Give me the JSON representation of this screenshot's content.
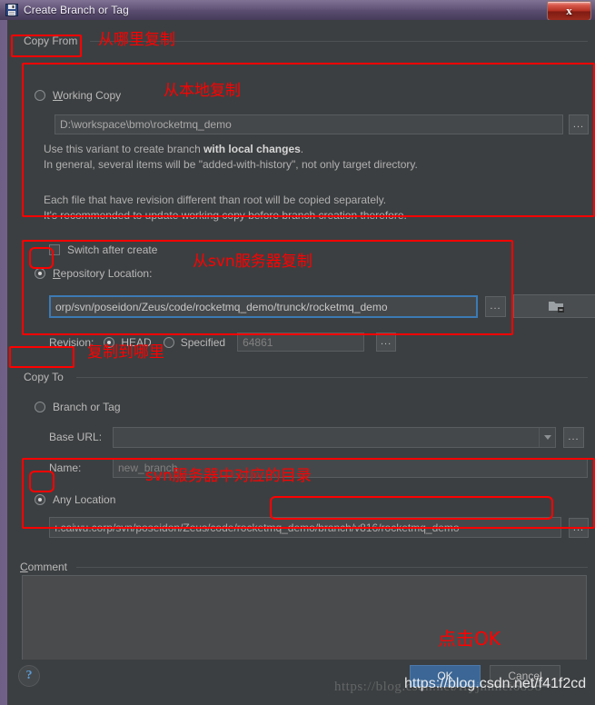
{
  "window": {
    "title": "Create Branch or Tag",
    "icon": "save-floppy-icon",
    "close_label": "x"
  },
  "copy_from": {
    "section_label": "Copy From",
    "annotation": "从哪里复制",
    "working_copy": {
      "label": "Working Copy",
      "selected": false,
      "path": "D:\\workspace\\bmo\\rocketmq_demo",
      "browse_label": "...",
      "annotation": "从本地复制",
      "info_line1_a": "Use this variant to create branch ",
      "info_line1_b": "with local changes",
      "info_line1_c": ".",
      "info_line2": "In general, several items will be \"added-with-history\", not only target directory.",
      "info_line3": "Each file that have revision different than root will be copied separately.",
      "info_line4": "It's recommended to update working copy before branch creation therefore."
    },
    "switch_after_create": {
      "label": "Switch after create",
      "checked": false
    },
    "repository_location": {
      "label": "Repository Location:",
      "selected": true,
      "annotation": "从svn服务器复制",
      "url": "orp/svn/poseidon/Zeus/code/rocketmq_demo/trunck/rocketmq_demo",
      "browse_label": "...",
      "folder_button_icon": "folder-icon",
      "revision": {
        "label": "Revision:",
        "head_label": "HEAD",
        "head_selected": true,
        "specified_label": "Specified",
        "specified_selected": false,
        "specified_value": "64861",
        "browse_label": "..."
      }
    }
  },
  "copy_to": {
    "section_label": "Copy To",
    "annotation": "复制到哪里",
    "branch_or_tag": {
      "label": "Branch or Tag",
      "selected": false,
      "base_url_label": "Base URL:",
      "base_url_value": "",
      "base_url_browse": "...",
      "name_label": "Name:",
      "name_value": "new_branch"
    },
    "any_location": {
      "label": "Any Location",
      "selected": true,
      "annotation": "svn服务器中对应的目录",
      "url_prefix": "ı.caiwu.corp/svn/poseidon/Zeus/code",
      "url_highlight": "/rocketmq_demo/branch/v816/rocketmq_demo",
      "browse_label": "..."
    }
  },
  "comment": {
    "section_label": "Comment",
    "value": ""
  },
  "footer": {
    "help_label": "?",
    "ok_label": "OK",
    "cancel_label": "Cancel",
    "ok_annotation": "点击OK"
  },
  "watermarks": {
    "back": "https://blog.csdn.net/fryjmmei6898",
    "front": "https://blog.csdn.net/f41f2cd"
  },
  "colors": {
    "dialog_bg": "#3c3f41",
    "annotation_red": "#ff0000",
    "accent_blue": "#3b6695",
    "focus_border": "#3c7ab5",
    "title_purple": "#5f5176"
  }
}
